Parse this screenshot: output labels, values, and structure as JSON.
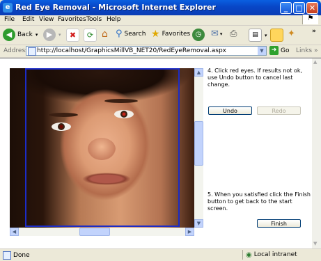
{
  "window": {
    "title": "Red Eye Removal - Microsoft Internet Explorer",
    "ie_icon": "ie-icon",
    "controls": [
      "minimize-icon",
      "maximize-icon",
      "close-icon"
    ]
  },
  "menu": {
    "items": [
      "File",
      "Edit",
      "View",
      "Favorites",
      "Tools",
      "Help"
    ]
  },
  "toolbar": {
    "back_label": "Back",
    "search_label": "Search",
    "favorites_label": "Favorites",
    "chevron": "»"
  },
  "address": {
    "label": "Address",
    "url": "http://localhost/GraphicsMillVB_NET20/RedEyeRemoval.aspx",
    "go_label": "Go",
    "links_label": "Links"
  },
  "page": {
    "step4_text": "4. Click red eyes. If results not ok, use Undo button to cancel last change.",
    "undo_label": "Undo",
    "redo_label": "Redo",
    "step5_text": "5. When you satisfied click the Finish button to get back to the start screen.",
    "finish_label": "Finish"
  },
  "status": {
    "text": "Done",
    "zone": "Local intranet"
  }
}
